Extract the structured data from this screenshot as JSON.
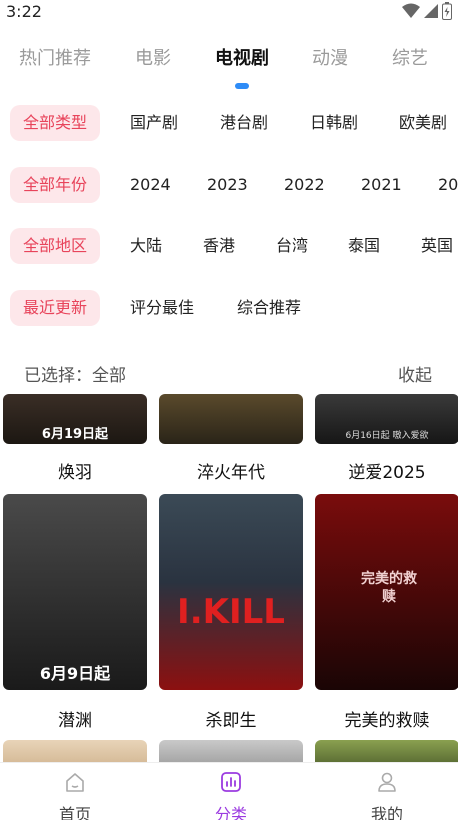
{
  "status_bar": {
    "time": "3:22"
  },
  "tabs": [
    "热门推荐",
    "电影",
    "电视剧",
    "动漫",
    "综艺"
  ],
  "active_tab": "电视剧",
  "filters": {
    "type": [
      "全部类型",
      "国产剧",
      "港台剧",
      "日韩剧",
      "欧美剧"
    ],
    "year": [
      "全部年份",
      "2024",
      "2023",
      "2022",
      "2021",
      "20"
    ],
    "region": [
      "全部地区",
      "大陆",
      "香港",
      "台湾",
      "泰国",
      "英国"
    ],
    "sort": [
      "最近更新",
      "评分最佳",
      "综合推荐"
    ]
  },
  "selected_label": "已选择：全部",
  "collapse_label": "收起",
  "rows": [
    [
      {
        "title": "焕羽",
        "poster_text": "6月19日起",
        "colors": [
          "#3a2e26",
          "#1c1712"
        ]
      },
      {
        "title": "淬火年代",
        "poster_text": "",
        "colors": [
          "#5a4a2c",
          "#2a2418"
        ]
      },
      {
        "title": "逆爱2025",
        "poster_text": "6月16日起 嗷入爱欲",
        "colors": [
          "#3a3a3a",
          "#161616"
        ]
      }
    ],
    [
      {
        "title": "潜渊",
        "poster_text": "6月9日起",
        "colors": [
          "#4a4a4a",
          "#1a1a1a"
        ]
      },
      {
        "title": "杀即生",
        "poster_text": "I.KILL",
        "colors": [
          "#3b4a56",
          "#8c1010"
        ]
      },
      {
        "title": "完美的救赎",
        "poster_text": "完美的救赎",
        "colors": [
          "#7a0c0c",
          "#1a0505"
        ]
      }
    ],
    [
      {
        "title": "",
        "poster_text": "",
        "colors": [
          "#e8d4b8",
          "#c8a880"
        ]
      },
      {
        "title": "",
        "poster_text": "",
        "colors": [
          "#c9c9c9",
          "#8a8a8a"
        ]
      },
      {
        "title": "",
        "poster_text": "",
        "colors": [
          "#8aa050",
          "#3a4a20"
        ]
      }
    ]
  ],
  "bottom_nav": [
    {
      "label": "首页",
      "icon": "home-icon"
    },
    {
      "label": "分类",
      "icon": "category-icon"
    },
    {
      "label": "我的",
      "icon": "profile-icon"
    }
  ],
  "active_nav": "分类",
  "colors": {
    "accent_pink": "#e8445b",
    "chip_bg": "#fde7ea",
    "tab_indicator": "#2e8cf7",
    "nav_active": "#9b3be0"
  }
}
